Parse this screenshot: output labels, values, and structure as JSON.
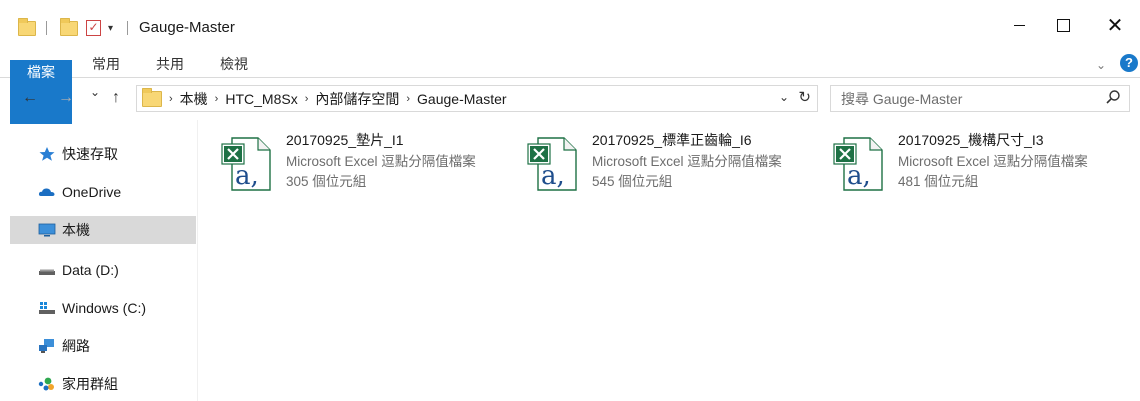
{
  "window": {
    "title": "Gauge-Master",
    "minimize_label": "",
    "maximize_label": "",
    "close_label": "✕"
  },
  "ribbon": {
    "tabs": [
      "檔案",
      "常用",
      "共用",
      "檢視"
    ],
    "collapse_icon": "chevron-down-icon",
    "help_label": "?"
  },
  "nav": {
    "back": "←",
    "forward": "→",
    "recent": "⌄",
    "up": "↑",
    "breadcrumbs": [
      "本機",
      "HTC_M8Sx",
      "內部儲存空間",
      "Gauge-Master"
    ],
    "refresh": "↻",
    "dropdown": "⌄",
    "search_placeholder": "搜尋 Gauge-Master"
  },
  "sidebar": {
    "items": [
      {
        "label": "快速存取",
        "icon": "star-icon"
      },
      {
        "label": "OneDrive",
        "icon": "cloud-icon"
      },
      {
        "label": "本機",
        "icon": "computer-icon",
        "selected": true
      },
      {
        "label": "Data (D:)",
        "icon": "drive-icon"
      },
      {
        "label": "Windows (C:)",
        "icon": "windows-drive-icon"
      },
      {
        "label": "網路",
        "icon": "network-icon"
      },
      {
        "label": "家用群組",
        "icon": "homegroup-icon"
      }
    ]
  },
  "files": [
    {
      "name": "20170925_墊片_I1",
      "type": "Microsoft Excel 逗點分隔值檔案",
      "size": "305 個位元組"
    },
    {
      "name": "20170925_標準正齒輪_I6",
      "type": "Microsoft Excel 逗點分隔值檔案",
      "size": "545 個位元組"
    },
    {
      "name": "20170925_機構尺寸_I3",
      "type": "Microsoft Excel 逗點分隔值檔案",
      "size": "481 個位元組"
    }
  ],
  "colors": {
    "accent": "#1979ca",
    "excel_green": "#1e7145",
    "selected_bg": "#d9d9d9",
    "folder": "#f8d775"
  }
}
